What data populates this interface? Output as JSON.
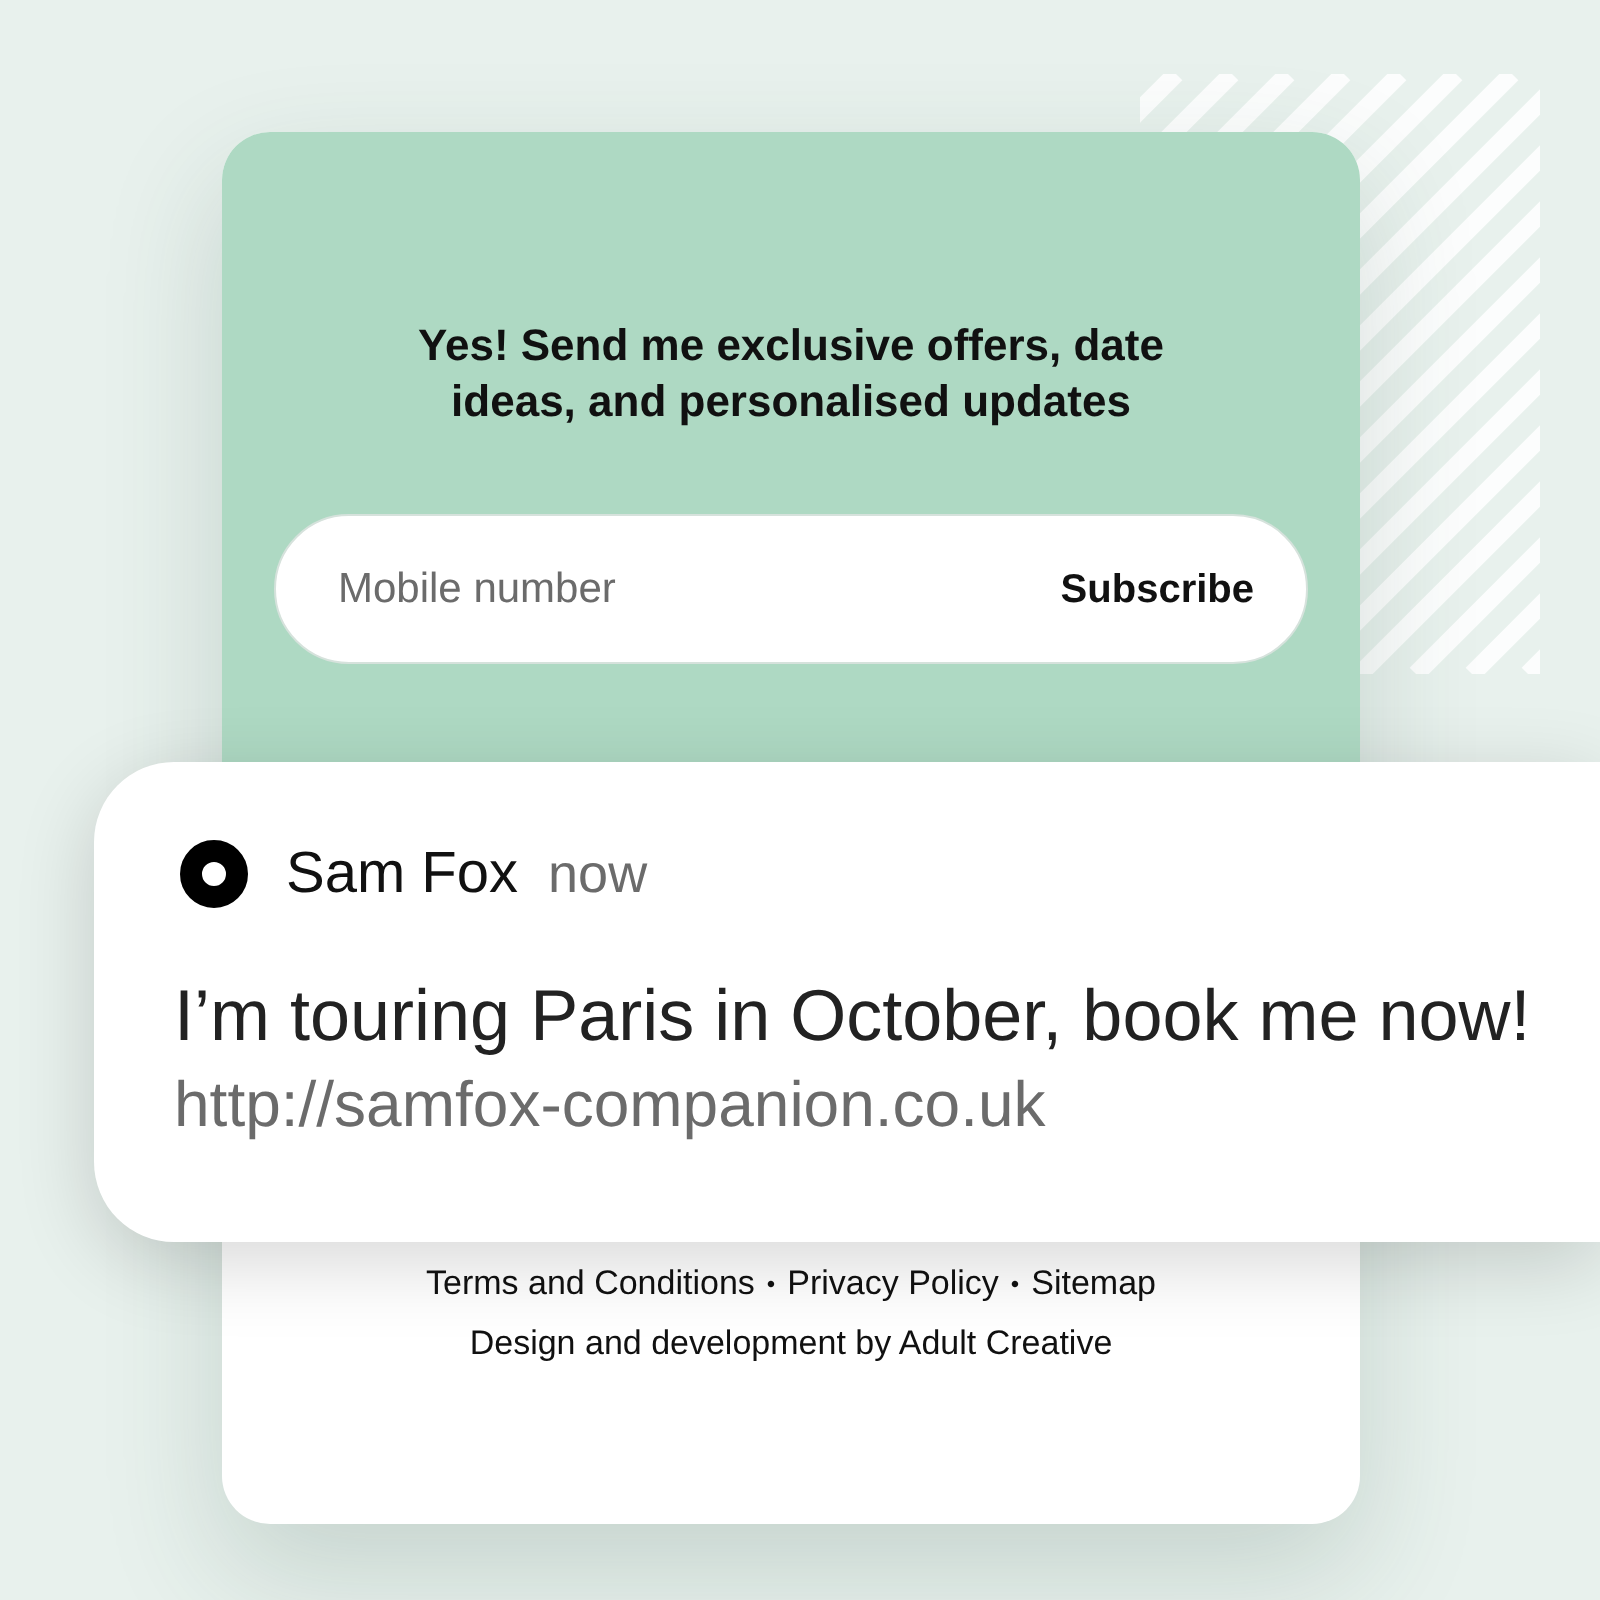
{
  "signup": {
    "heading": "Yes! Send me exclusive offers, date ideas, and personalised updates",
    "field": {
      "placeholder": "Mobile number"
    },
    "button": "Subscribe"
  },
  "notification": {
    "sender": "Sam Fox",
    "time": "now",
    "message": "I’m touring Paris in October, book me now!",
    "url": "http://samfox-companion.co.uk"
  },
  "footer": {
    "items": [
      {
        "kind": "link",
        "text": "Terms and Conditions"
      },
      {
        "kind": "separator",
        "text": "•"
      },
      {
        "kind": "link",
        "text": "Privacy Policy"
      },
      {
        "kind": "separator",
        "text": "•"
      },
      {
        "kind": "link",
        "text": "Sitemap"
      }
    ],
    "credit": "Design and development by Adult Creative"
  }
}
